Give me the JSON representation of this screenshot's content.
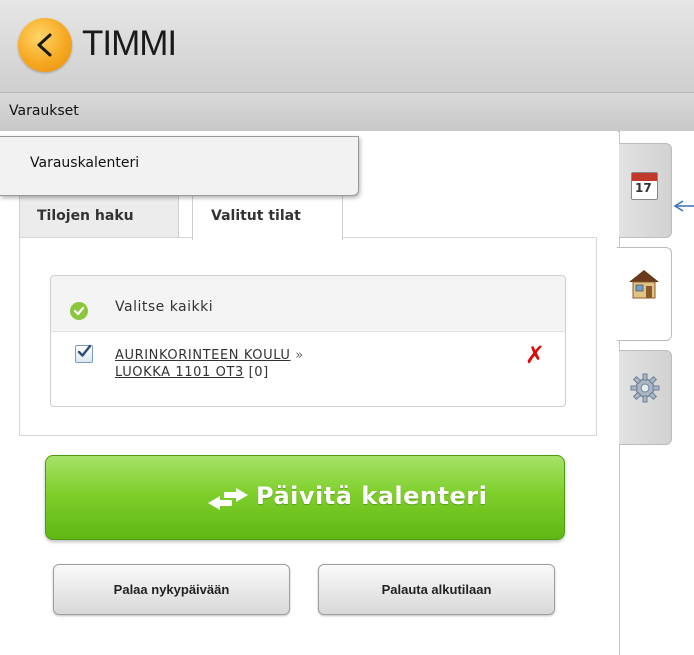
{
  "app": {
    "title": "TIMMI"
  },
  "menu": {
    "top_item": "Varaukset",
    "dropdown_item": "Varauskalenteri"
  },
  "tabs": [
    {
      "label": "Tilojen haku",
      "active": false
    },
    {
      "label": "Valitut tilat",
      "active": true
    }
  ],
  "selection": {
    "select_all_label": "Valitse kaikki",
    "items": [
      {
        "place": "AURINKORINTEEN KOULU",
        "separator": "»",
        "room": "LUOKKA 1101 OT3",
        "count": "[0]",
        "checked": true
      }
    ]
  },
  "buttons": {
    "update_calendar": "Päivitä kalenteri",
    "back_to_today": "Palaa nykypäivään",
    "reset": "Palauta alkutilaan"
  },
  "side_tabs": [
    {
      "icon": "calendar-icon",
      "text": "17"
    },
    {
      "icon": "home-icon"
    },
    {
      "icon": "gear-icon"
    }
  ],
  "colors": {
    "accent_green": "#7fcf2b",
    "remove_red": "#dd0a0a",
    "logo_orange": "#f6a821"
  }
}
